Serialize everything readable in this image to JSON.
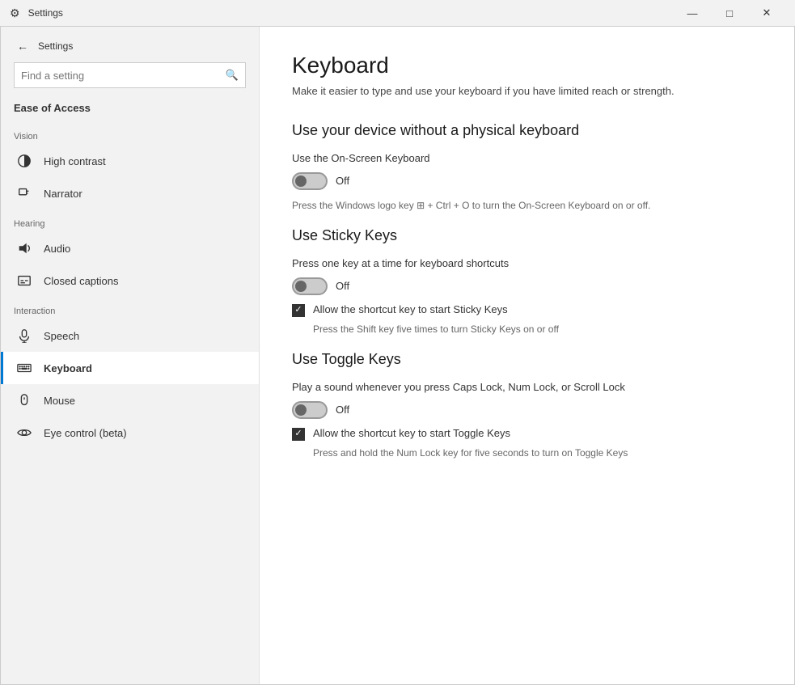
{
  "titlebar": {
    "title": "Settings",
    "back_label": "←",
    "minimize": "—",
    "maximize": "□",
    "close": "✕"
  },
  "sidebar": {
    "back_icon": "←",
    "title": "Settings",
    "search_placeholder": "Find a setting",
    "category": "Ease of Access",
    "sections": [
      {
        "label": "Vision",
        "items": [
          {
            "id": "high-contrast",
            "label": "High contrast",
            "icon": "contrast"
          },
          {
            "id": "narrator",
            "label": "Narrator",
            "icon": "narrator"
          }
        ]
      },
      {
        "label": "Hearing",
        "items": [
          {
            "id": "audio",
            "label": "Audio",
            "icon": "audio"
          },
          {
            "id": "closed-captions",
            "label": "Closed captions",
            "icon": "captions"
          }
        ]
      },
      {
        "label": "Interaction",
        "items": [
          {
            "id": "speech",
            "label": "Speech",
            "icon": "speech"
          },
          {
            "id": "keyboard",
            "label": "Keyboard",
            "icon": "keyboard",
            "active": true
          },
          {
            "id": "mouse",
            "label": "Mouse",
            "icon": "mouse"
          },
          {
            "id": "eye-control",
            "label": "Eye control (beta)",
            "icon": "eye"
          }
        ]
      }
    ]
  },
  "main": {
    "title": "Keyboard",
    "subtitle": "Make it easier to type and use your keyboard if you have limited reach or strength.",
    "sections": [
      {
        "id": "on-screen",
        "heading": "Use your device without a physical keyboard",
        "settings": [
          {
            "label": "Use the On-Screen Keyboard",
            "toggle": "off",
            "toggle_label": "Off",
            "hint": "Press the Windows logo key ⊞ + Ctrl + O to turn the On-Screen Keyboard on or off."
          }
        ]
      },
      {
        "id": "sticky-keys",
        "heading": "Use Sticky Keys",
        "settings": [
          {
            "label": "Press one key at a time for keyboard shortcuts",
            "toggle": "off",
            "toggle_label": "Off",
            "checkbox": {
              "checked": true,
              "label": "Allow the shortcut key to start Sticky Keys",
              "hint": "Press the Shift key five times to turn Sticky Keys on or off"
            }
          }
        ]
      },
      {
        "id": "toggle-keys",
        "heading": "Use Toggle Keys",
        "settings": [
          {
            "label": "Play a sound whenever you press Caps Lock, Num Lock, or Scroll Lock",
            "toggle": "off",
            "toggle_label": "Off",
            "checkbox": {
              "checked": true,
              "label": "Allow the shortcut key to start Toggle Keys",
              "hint": "Press and hold the Num Lock key for five seconds to turn on Toggle Keys"
            }
          }
        ]
      }
    ]
  }
}
